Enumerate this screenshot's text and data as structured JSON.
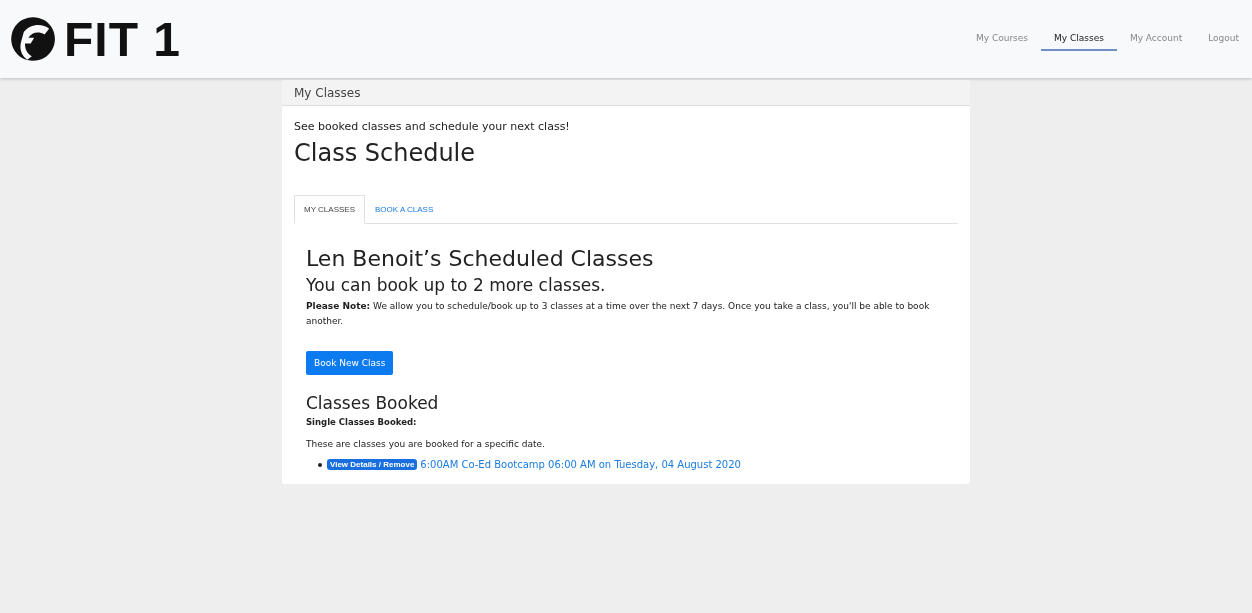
{
  "logo": {
    "text": "FIT 1"
  },
  "nav": [
    {
      "label": "My Courses",
      "selected": false
    },
    {
      "label": "My Classes",
      "selected": true
    },
    {
      "label": "My Account",
      "selected": false
    },
    {
      "label": "Logout",
      "selected": false
    }
  ],
  "card": {
    "header": "My Classes",
    "intro": "See booked classes and schedule your next class!",
    "title": "Class Schedule"
  },
  "tabs": [
    {
      "label": "MY CLASSES",
      "selected": true
    },
    {
      "label": "BOOK A CLASS",
      "selected": false
    }
  ],
  "panel": {
    "heading": "Len Benoit’s Scheduled Classes",
    "subheading": "You can book up to 2 more classes.",
    "note": "**Please Note:** We allow you to schedule/book up to 3 classes at a time over the next 7 days. Once you take a class, you'll be able to book another.",
    "button": "Book New Class",
    "booked_heading": "Classes Booked",
    "booked_label": "Single Classes Booked:",
    "booked_desc": "These are classes you are booked for a specific date."
  },
  "bookings": [
    {
      "badge": "View Details / Remove",
      "text": "6:00AM Co-Ed Bootcamp 06:00 AM on Tuesday, 04 August 2020"
    }
  ]
}
